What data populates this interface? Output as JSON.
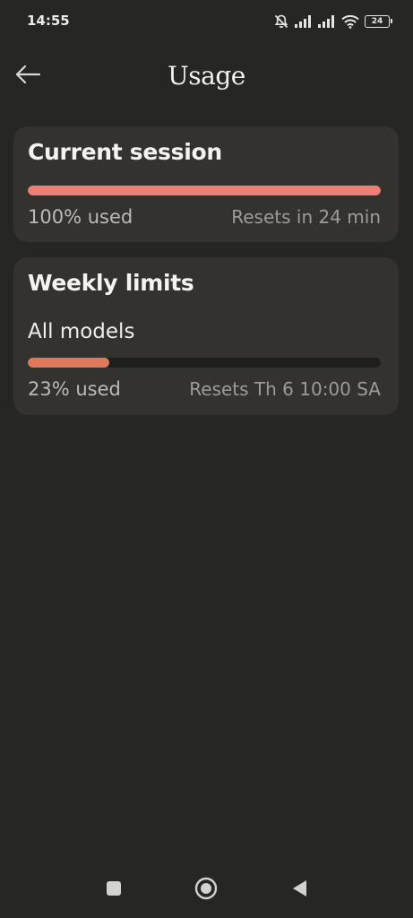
{
  "status_bar": {
    "time": "14:55",
    "battery_level": "24",
    "icons": [
      "muted-bell-icon",
      "signal-icon",
      "signal-icon",
      "wifi-icon",
      "battery-icon"
    ]
  },
  "header": {
    "title": "Usage",
    "back_icon": "arrow-left-icon"
  },
  "current_session": {
    "title": "Current session",
    "progress_fraction": 1.0,
    "progress_color": "#ef7e75",
    "used_label": "100% used",
    "reset_label": "Resets in 24 min"
  },
  "weekly_limits": {
    "title": "Weekly limits",
    "model_label": "All models",
    "progress_fraction": 0.23,
    "progress_color": "#e0785c",
    "used_label": "23% used",
    "reset_label": "Resets Th 6 10:00 SA"
  },
  "nav_bar": {
    "items": [
      "recent-apps-icon",
      "home-icon",
      "back-triangle-icon"
    ]
  },
  "colors": {
    "background": "#262624",
    "card": "#33322f",
    "track": "#1e1e1c"
  }
}
